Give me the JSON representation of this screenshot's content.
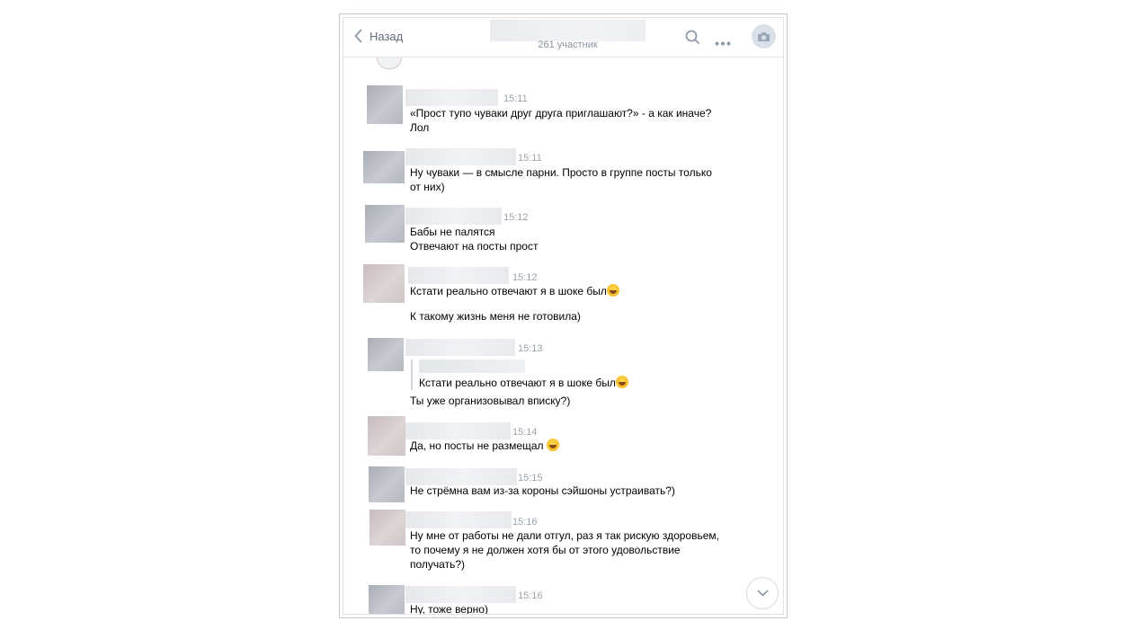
{
  "header": {
    "back_label": "Назад",
    "subtitle": "261 участник"
  },
  "messages": [
    {
      "time": "15:11",
      "lines": "«Прост тупо чуваки друг друга приглашают?» - а как иначе?\nЛол"
    },
    {
      "time": "15:11",
      "lines": "Ну чуваки — в смысле парни. Просто в группе посты только\nот них)"
    },
    {
      "time": "15:12",
      "lines": "Бабы не палятся\nОтвечают на посты прост"
    },
    {
      "time": "15:12",
      "lines": "Кстати реально отвечают я в шоке был",
      "second": "К такому жизнь меня не готовила)"
    },
    {
      "time": "15:13",
      "quote": "Кстати реально отвечают я в шоке был",
      "lines": "Ты уже организовывал вписку?)"
    },
    {
      "time": "15:14",
      "lines": "Да, но посты не размещал "
    },
    {
      "time": "15:15",
      "lines": "Не стрёмна вам из-за короны сэйшоны устраивать?)"
    },
    {
      "time": "15:16",
      "lines": "Ну мне от работы не дали отгул, раз я так рискую здоровьем,\nто почему я не должен хотя бы от этого удовольствие\nполучать?)"
    },
    {
      "time": "15:16",
      "lines": "Ну, тоже верно)"
    }
  ],
  "icons": {
    "back": "chevron-left-icon",
    "search": "search-icon",
    "more": "more-horizontal-icon",
    "camera": "camera-icon",
    "emoji": "grinning-face-emoji",
    "scroll_down": "chevron-down-icon"
  },
  "colors": {
    "accent_icon": "#8c9aaa",
    "time": "#9aa3ad",
    "border": "#e4e6ea"
  }
}
